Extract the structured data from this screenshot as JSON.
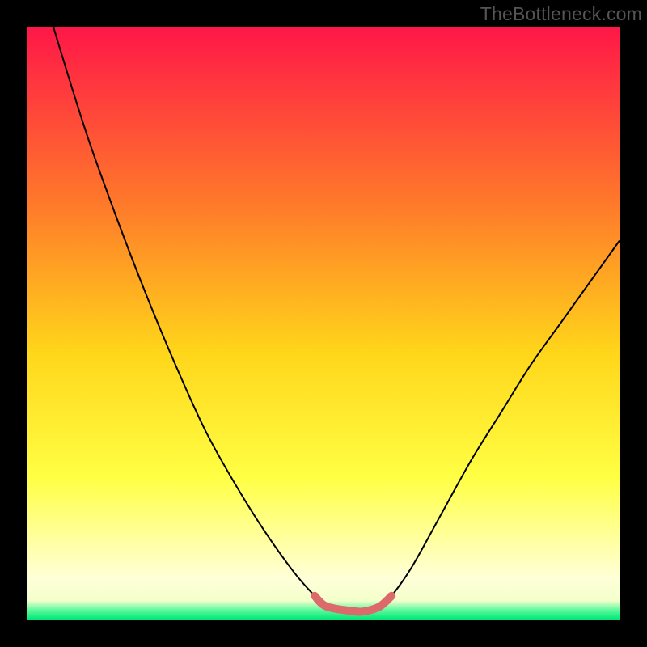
{
  "watermark": "TheBottleneck.com",
  "colors": {
    "background": "#000000",
    "gradient_top": "#ff1748",
    "gradient_mid1": "#ff7a2a",
    "gradient_mid2": "#ffd61a",
    "gradient_mid3": "#ffff44",
    "gradient_bottom": "#ffffd8",
    "very_bottom": "#00e676",
    "curve_stroke": "#000000",
    "segment_stroke": "#dc6a6a"
  },
  "chart_data": {
    "type": "line",
    "title": "",
    "xlabel": "",
    "ylabel": "",
    "xlim": [
      0,
      100
    ],
    "ylim": [
      0,
      100
    ],
    "series": [
      {
        "name": "bottleneck-curve",
        "x": [
          0,
          5,
          10,
          15,
          20,
          25,
          30,
          35,
          40,
          45,
          48.5,
          50.5,
          55,
          57,
          59.5,
          61.5,
          65,
          70,
          75,
          80,
          85,
          90,
          95,
          100
        ],
        "y": [
          115,
          98,
          82,
          68,
          55,
          43,
          32,
          23,
          15,
          8,
          4,
          2.2,
          1.4,
          1.4,
          2.2,
          4,
          9,
          18,
          27,
          35,
          43,
          50,
          57,
          64
        ]
      },
      {
        "name": "optimal-segment",
        "x": [
          48.5,
          50.5,
          55,
          57,
          59.5,
          61.5
        ],
        "y": [
          4,
          2.2,
          1.4,
          1.4,
          2.2,
          4
        ]
      }
    ],
    "gradient_stops": [
      {
        "pos": 0,
        "color": "#ff1748"
      },
      {
        "pos": 0.3,
        "color": "#ff7a2a"
      },
      {
        "pos": 0.55,
        "color": "#ffd61a"
      },
      {
        "pos": 0.76,
        "color": "#ffff44"
      },
      {
        "pos": 0.93,
        "color": "#ffffd8"
      },
      {
        "pos": 0.968,
        "color": "#f4ffcc"
      },
      {
        "pos": 0.985,
        "color": "#56f99b"
      },
      {
        "pos": 1.0,
        "color": "#00e676"
      }
    ]
  }
}
